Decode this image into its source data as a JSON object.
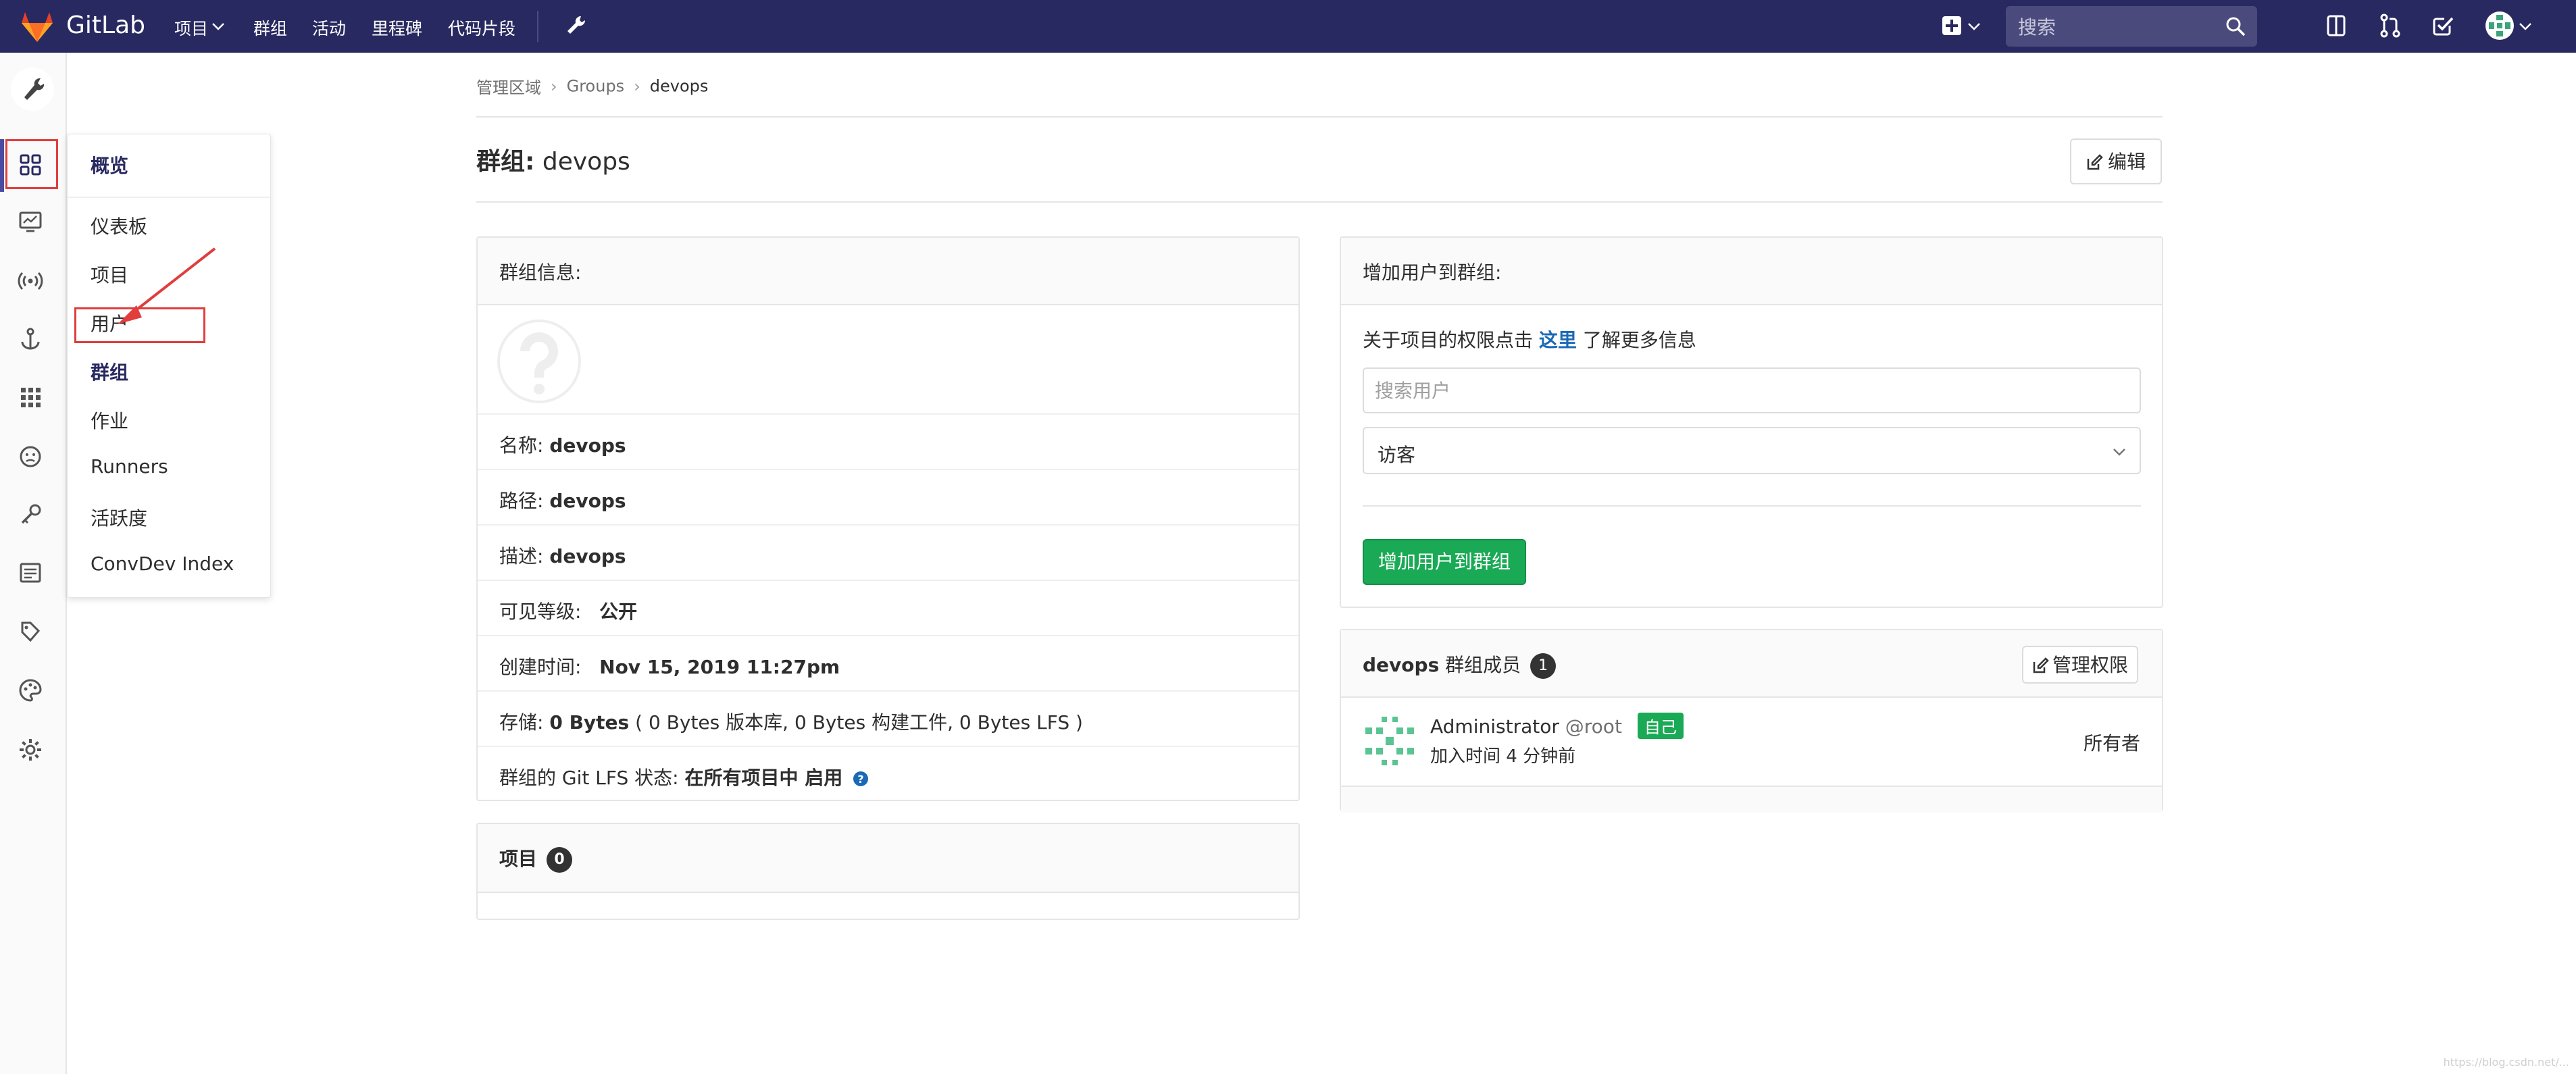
{
  "navbar": {
    "brand": "GitLab",
    "items": [
      "项目",
      "群组",
      "活动",
      "里程碑",
      "代码片段"
    ],
    "search_placeholder": "搜索"
  },
  "flyout": {
    "header": "概览",
    "items": [
      "仪表板",
      "项目",
      "用户",
      "群组",
      "作业",
      "Runners",
      "活跃度",
      "ConvDev Index"
    ],
    "active": "群组"
  },
  "breadcrumb": [
    "管理区域",
    "Groups",
    "devops"
  ],
  "page": {
    "title_prefix": "群组:",
    "title_name": "devops",
    "edit_label": "编辑"
  },
  "group_info": {
    "title": "群组信息:",
    "name_label": "名称:",
    "name": "devops",
    "path_label": "路径:",
    "path": "devops",
    "desc_label": "描述:",
    "desc": "devops",
    "visibility_label": "可见等级:",
    "visibility": "公开",
    "created_label": "创建时间:",
    "created": "Nov 15, 2019 11:27pm",
    "storage_label": "存储:",
    "storage_total": "0 Bytes",
    "storage_detail": "( 0 Bytes 版本库, 0 Bytes 构建工件, 0 Bytes LFS )",
    "lfs_label": "群组的 Git LFS 状态:",
    "lfs_status": "在所有项目中 启用"
  },
  "projects_panel": {
    "title": "项目",
    "count": "0"
  },
  "add_user": {
    "title": "增加用户到群组:",
    "info_before": "关于项目的权限点击",
    "info_link": "这里",
    "info_after": "了解更多信息",
    "search_placeholder": "搜索用户",
    "role_selected": "访客",
    "submit_label": "增加用户到群组"
  },
  "members": {
    "group_name": "devops",
    "title_suffix": "群组成员",
    "count": "1",
    "manage_label": "管理权限",
    "list": [
      {
        "name": "Administrator",
        "username": "@root",
        "self_tag": "自己",
        "joined": "加入时间 4 分钟前",
        "role": "所有者"
      }
    ]
  },
  "colors": {
    "navbar": "#292961",
    "accent_green": "#1aaa55",
    "highlight_red": "#e13d3d",
    "link_blue": "#1b69b6"
  },
  "watermark": "https://blog.csdn.net/..."
}
